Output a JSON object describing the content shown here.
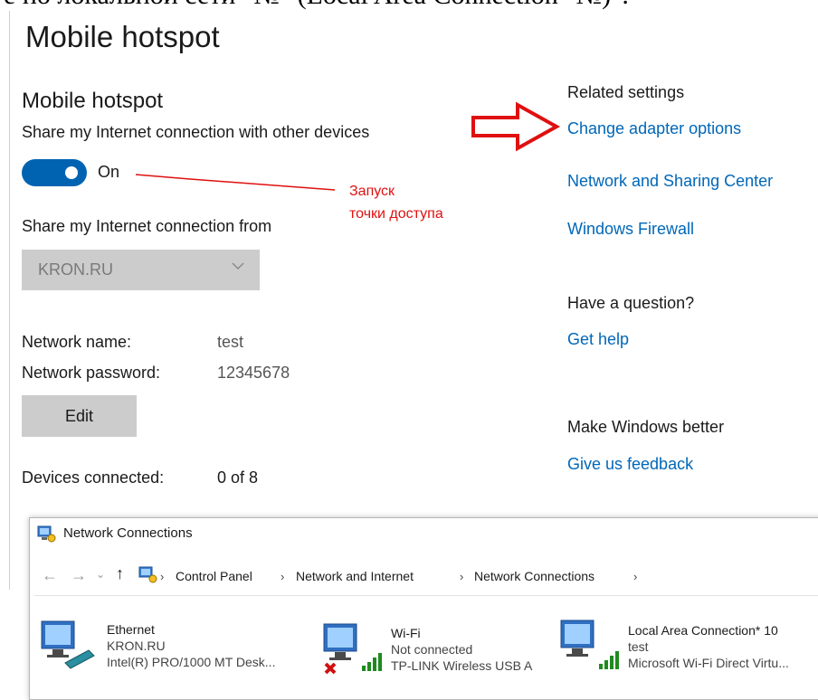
{
  "caption": "е по локальной сети \"№\" (Local Area Connection \"№)\".",
  "settings": {
    "page_title": "Mobile hotspot",
    "section_title": "Mobile hotspot",
    "share_label": "Share my Internet connection with other devices",
    "toggle_state": "On",
    "share_from_label": "Share my Internet connection from",
    "share_from_value": "KRON.RU",
    "network_name_label": "Network name:",
    "network_name_value": "test",
    "network_password_label": "Network password:",
    "network_password_value": "12345678",
    "edit_label": "Edit",
    "devices_label": "Devices connected:",
    "devices_value": "0 of 8"
  },
  "related": {
    "heading": "Related settings",
    "links": [
      "Change adapter options",
      "Network and Sharing Center",
      "Windows Firewall"
    ],
    "question_heading": "Have a question?",
    "help_link": "Get help",
    "better_heading": "Make Windows better",
    "feedback_link": "Give us feedback"
  },
  "annotation": {
    "line1": "Запуск",
    "line2": "точки доступа",
    "color": "#e01010"
  },
  "network_connections": {
    "title": "Network Connections",
    "breadcrumb": [
      "Control Panel",
      "Network and Internet",
      "Network Connections"
    ],
    "adapters": [
      {
        "name": "Ethernet",
        "status": "KRON.RU",
        "device": "Intel(R) PRO/1000 MT Desk..."
      },
      {
        "name": "Wi-Fi",
        "status": "Not connected",
        "device": "TP-LINK Wireless USB A"
      },
      {
        "name": "Local Area Connection* 10",
        "status": "test",
        "device": "Microsoft Wi-Fi Direct Virtu..."
      }
    ]
  },
  "colors": {
    "accent": "#0063b1",
    "link": "#0067b8",
    "arrow": "#e01010"
  }
}
